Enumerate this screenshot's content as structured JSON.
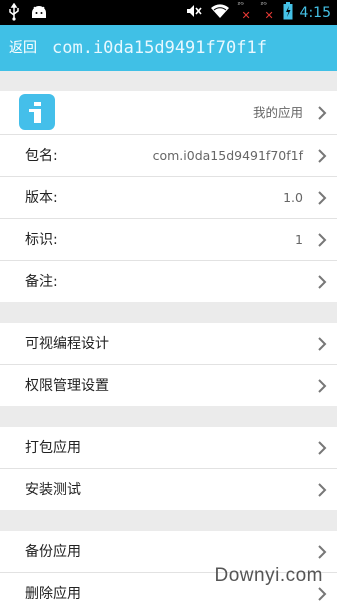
{
  "status": {
    "time": "4:15",
    "icons": [
      "usb-icon",
      "android-icon",
      "mute-icon",
      "wifi-icon",
      "signal-no-service-icon",
      "signal-no-service-icon",
      "battery-charging-icon"
    ]
  },
  "header": {
    "back_label": "返回",
    "title": "com.i0da15d9491f70f1f"
  },
  "app_row": {
    "value": "我的应用"
  },
  "details": [
    {
      "label": "包名:",
      "value": "com.i0da15d9491f70f1f"
    },
    {
      "label": "版本:",
      "value": "1.0"
    },
    {
      "label": "标识:",
      "value": "1"
    },
    {
      "label": "备注:",
      "value": ""
    }
  ],
  "section_design": [
    {
      "label": "可视编程设计"
    },
    {
      "label": "权限管理设置"
    }
  ],
  "section_build": [
    {
      "label": "打包应用"
    },
    {
      "label": "安装测试"
    }
  ],
  "section_manage": [
    {
      "label": "备份应用"
    },
    {
      "label": "删除应用"
    }
  ],
  "watermark": "Downyi.com",
  "colors": {
    "accent": "#40c0e6",
    "background": "#ebebeb",
    "row": "#ffffff"
  }
}
